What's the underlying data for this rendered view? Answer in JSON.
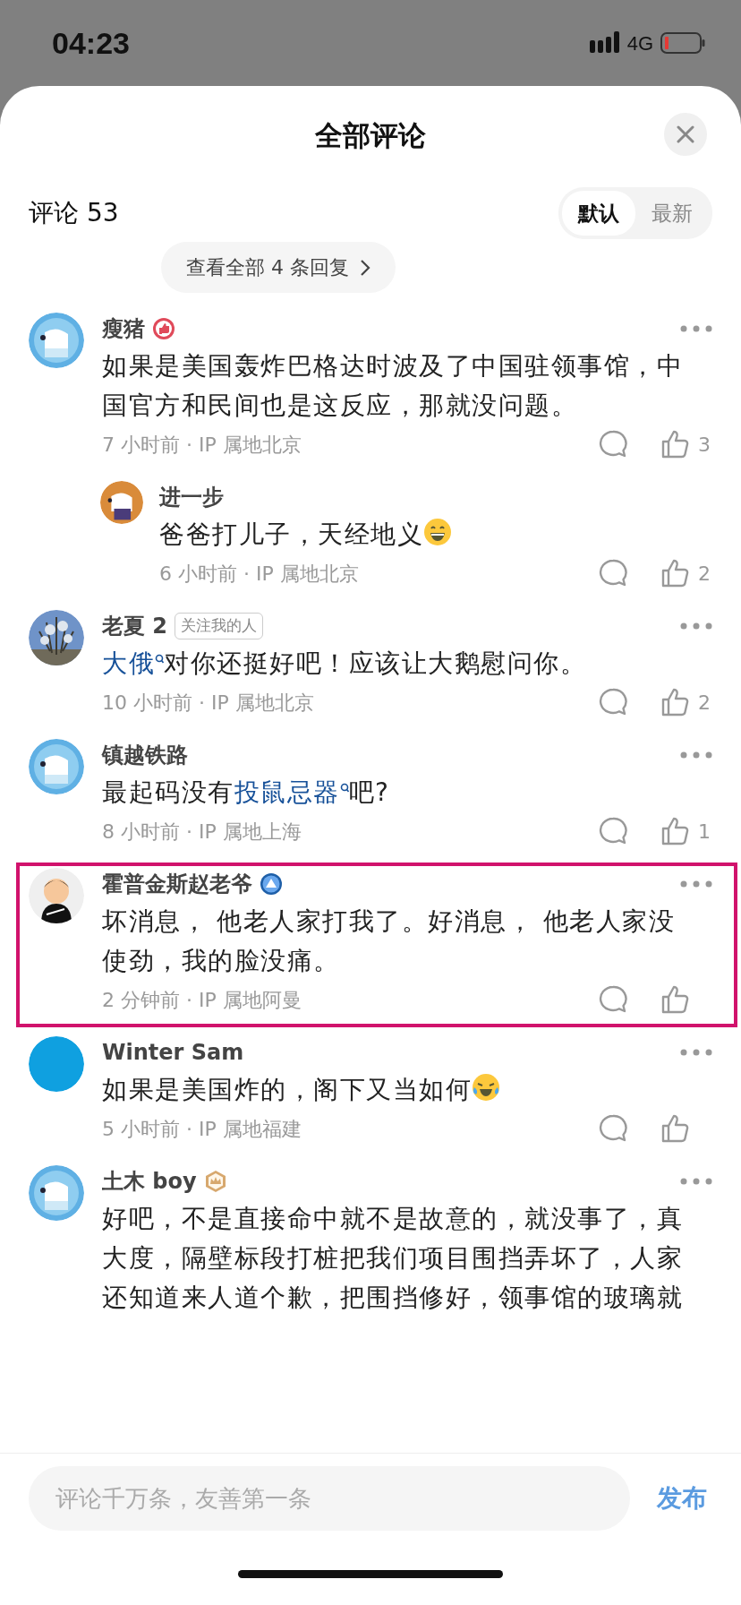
{
  "status_bar": {
    "time": "04:23",
    "network": "4G"
  },
  "header": {
    "title": "全部评论"
  },
  "summary": {
    "label": "评论 53",
    "sort_options": [
      {
        "label": "默认",
        "selected": true
      },
      {
        "label": "最新",
        "selected": false
      }
    ]
  },
  "view_replies": {
    "label": "查看全部 4 条回复"
  },
  "comments": [
    {
      "author": "瘦猪",
      "avatar": {
        "kind": "bear"
      },
      "badge": {
        "kind": "thumb"
      },
      "segments": [
        {
          "text": "如果是美国轰炸巴格达时波及了中国驻领事馆，中国官方和民间也是这反应，那就没问题。",
          "link": false
        }
      ],
      "meta": "7 小时前 · IP 属地北京",
      "likes": "3",
      "highlighted": false,
      "replies": [
        {
          "author": "进一步",
          "avatar": {
            "kind": "bear-orange"
          },
          "segments": [
            {
              "text": "爸爸打儿子，天经地义",
              "link": false
            }
          ],
          "emoji": {
            "kind": "grin"
          },
          "meta": "6 小时前 · IP 属地北京",
          "likes": "2"
        }
      ]
    },
    {
      "author": "老夏 2",
      "avatar": {
        "kind": "picture"
      },
      "tag": "关注我的人",
      "segments": [
        {
          "text": "大俄",
          "link": true
        },
        {
          "text": "对你还挺好吧！应该让大鹅慰问你。",
          "link": false
        }
      ],
      "meta": "10 小时前 · IP 属地北京",
      "likes": "2",
      "highlighted": false
    },
    {
      "author": "镇越铁路",
      "avatar": {
        "kind": "bear"
      },
      "segments": [
        {
          "text": "最起码没有",
          "link": false
        },
        {
          "text": "投鼠忌器",
          "link": true
        },
        {
          "text": "吧?",
          "link": false
        }
      ],
      "meta": "8 小时前 · IP 属地上海",
      "likes": "1",
      "highlighted": false
    },
    {
      "author": "霍普金斯赵老爷",
      "avatar": {
        "kind": "figure"
      },
      "badge": {
        "kind": "triangle"
      },
      "segments": [
        {
          "text": "坏消息， 他老人家打我了。好消息， 他老人家没使劲，我的脸没痛。",
          "link": false
        }
      ],
      "meta": "2 分钟前 · IP 属地阿曼",
      "highlighted": true
    },
    {
      "author": "Winter Sam",
      "avatar": {
        "kind": "plain"
      },
      "segments": [
        {
          "text": "如果是美国炸的，阁下又当如何",
          "link": false
        }
      ],
      "emoji": {
        "kind": "laugh-cry"
      },
      "meta": "5 小时前 · IP 属地福建",
      "highlighted": false
    },
    {
      "author": "土木 boy",
      "avatar": {
        "kind": "bear"
      },
      "badge": {
        "kind": "crown"
      },
      "segments": [
        {
          "text": "好吧，不是直接命中就不是故意的，就没事了，真大度，隔壁标段打桩把我们项目围挡弄坏了，人家还知道来人道个歉，把围挡修好，领事馆的玻璃就",
          "link": false
        }
      ],
      "highlighted": false
    }
  ],
  "composer": {
    "placeholder": "评论千万条，友善第一条",
    "submit": "发布"
  }
}
